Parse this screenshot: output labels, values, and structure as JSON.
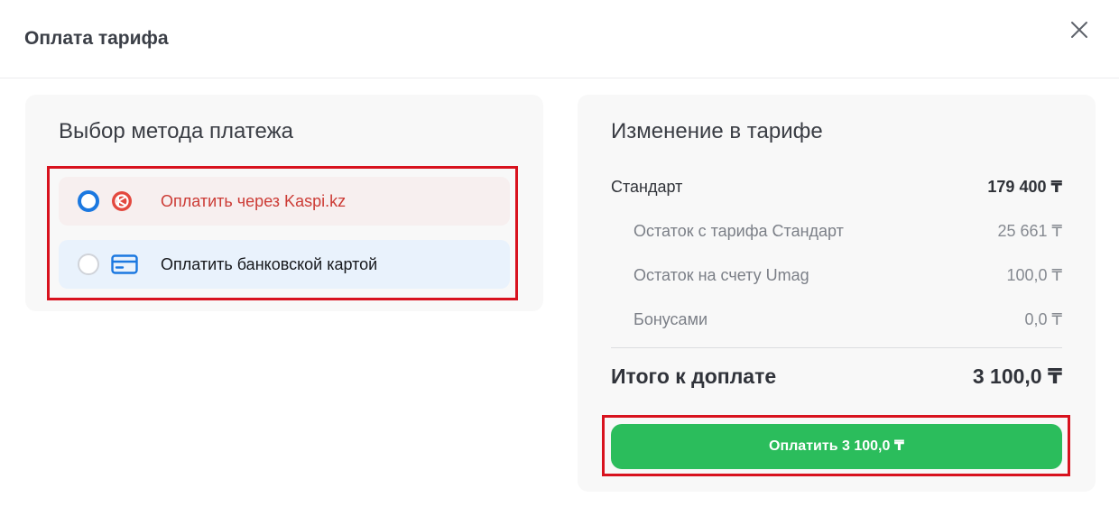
{
  "modal": {
    "title": "Оплата тарифа",
    "close_icon": "close-icon"
  },
  "payment_methods": {
    "heading": "Выбор метода платежа",
    "items": [
      {
        "label": "Оплатить через Kaspi.kz",
        "icon": "kaspi-logo-icon",
        "selected": true
      },
      {
        "label": "Оплатить банковской картой",
        "icon": "bank-card-icon",
        "selected": false
      }
    ]
  },
  "tariff_change": {
    "heading": "Изменение в тарифе",
    "plan": {
      "label": "Стандарт",
      "value": "179 400 ₸"
    },
    "deductions": [
      {
        "label": "Остаток с тарифа Стандарт",
        "value": "25 661 ₸"
      },
      {
        "label": "Остаток на счету Umag",
        "value": "100,0 ₸"
      },
      {
        "label": "Бонусами",
        "value": "0,0 ₸"
      }
    ],
    "total": {
      "label": "Итого к доплате",
      "value": "3 100,0 ₸"
    },
    "pay_button": "Оплатить 3 100,0 ₸"
  },
  "colors": {
    "accent_blue": "#1b78e0",
    "kaspi_red": "#d93a34",
    "pay_green": "#2bbd5c",
    "highlight_red": "#d8121e"
  }
}
